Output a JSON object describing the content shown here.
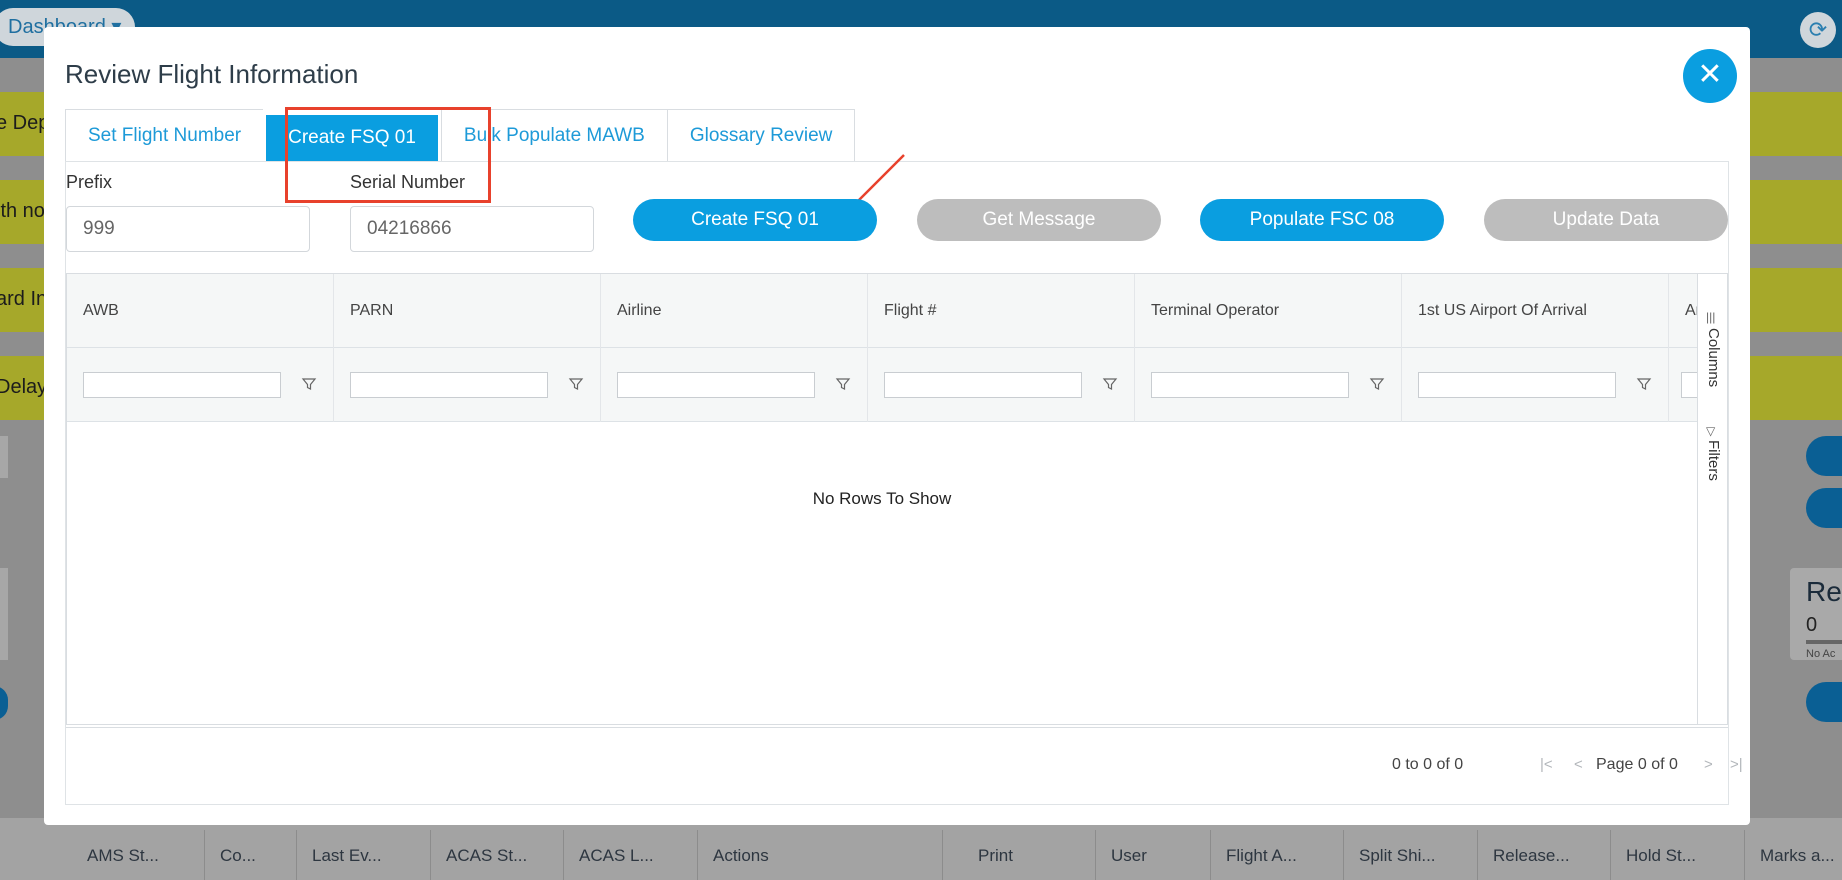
{
  "background": {
    "dashboard_label": "Dashboard",
    "cards": [
      "e Dep",
      "ith no",
      "ard In",
      "Delaye"
    ],
    "panel": {
      "title": "Rel",
      "value": "0",
      "sub": "No Ac"
    },
    "columns": [
      "AMS St...",
      "Co...",
      "Last Ev...",
      "ACAS St...",
      "ACAS L...",
      "Actions",
      "Print",
      "User",
      "Flight A...",
      "Split Shi...",
      "Release...",
      "Hold St...",
      "Marks a..."
    ]
  },
  "modal": {
    "title": "Review Flight Information",
    "close_icon": "close-icon",
    "tabs": [
      {
        "label": "Set Flight Number",
        "active": false
      },
      {
        "label": "Create FSQ 01",
        "active": true
      },
      {
        "label": "Bulk Populate MAWB",
        "active": false
      },
      {
        "label": "Glossary Review",
        "active": false
      }
    ],
    "prefix": {
      "label": "Prefix",
      "value": "999"
    },
    "serial": {
      "label": "Serial Number",
      "value": "04216866"
    },
    "buttons": {
      "create_fsq": "Create FSQ 01",
      "get_message": "Get Message",
      "populate_fsc": "Populate FSC 08",
      "update_data": "Update Data"
    },
    "grid": {
      "columns": [
        "AWB",
        "PARN",
        "Airline",
        "Flight #",
        "Terminal Operator",
        "1st US Airport Of Arrival",
        "Ar"
      ],
      "empty_text": "No Rows To Show",
      "side_tabs": {
        "columns": "Columns",
        "filters": "Filters"
      }
    },
    "paging": {
      "summary": "0 to 0 of 0",
      "page_label": "Page",
      "page_current": "0",
      "of_label": "of",
      "page_total": "0"
    }
  },
  "colors": {
    "accent": "#0a9ee0",
    "annotation": "#e8412c",
    "disabled": "#bdbdbd"
  }
}
